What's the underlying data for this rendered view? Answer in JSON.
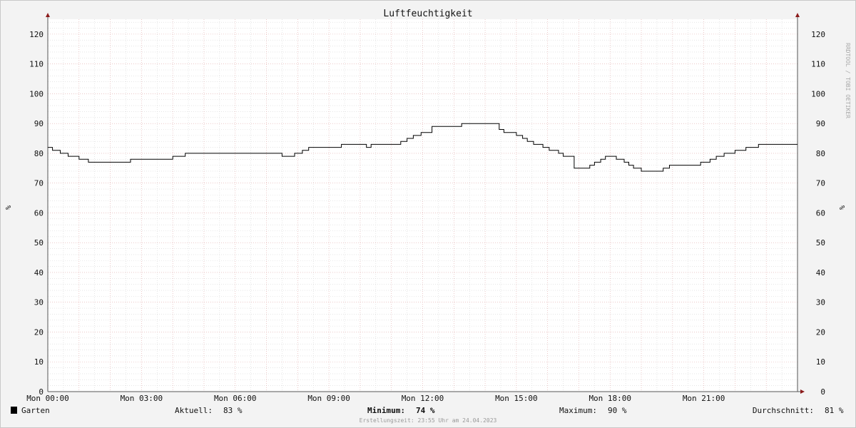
{
  "title": "Luftfeuchtigkeit",
  "watermark": "RRDTOOL / TOBI OETIKER",
  "chart_data": {
    "type": "line",
    "title": "Luftfeuchtigkeit",
    "ylabel": "%",
    "ylabel_right": "%",
    "xlabel": "",
    "ylim": [
      0,
      125
    ],
    "yticks": [
      0,
      10,
      20,
      30,
      40,
      50,
      60,
      70,
      80,
      90,
      100,
      110,
      120
    ],
    "xlim_hours": [
      0,
      24
    ],
    "xtick_hours": [
      0,
      3,
      6,
      9,
      12,
      15,
      18,
      21
    ],
    "xtick_labels": [
      "Mon 00:00",
      "Mon 03:00",
      "Mon 06:00",
      "Mon 09:00",
      "Mon 12:00",
      "Mon 15:00",
      "Mon 18:00",
      "Mon 21:00"
    ],
    "grid": true,
    "line_color": "#000000",
    "series": [
      {
        "name": "Garten",
        "x": [
          0,
          0.15,
          0.4,
          0.5,
          0.65,
          0.7,
          1.0,
          1.3,
          2.65,
          4.0,
          4.4,
          7.5,
          7.9,
          8.15,
          8.35,
          8.6,
          9.4,
          10.2,
          10.35,
          10.9,
          11.3,
          11.5,
          11.7,
          11.95,
          12.3,
          13.25,
          14.45,
          14.6,
          15.0,
          15.2,
          15.35,
          15.55,
          15.85,
          16.05,
          16.35,
          16.5,
          16.85,
          17.35,
          17.5,
          17.7,
          17.85,
          18.2,
          18.45,
          18.6,
          18.75,
          19.0,
          19.7,
          19.9,
          20.35,
          20.9,
          21.2,
          21.4,
          21.65,
          22.0,
          22.35,
          22.75,
          24.0
        ],
        "values": [
          82,
          81,
          80,
          80,
          79,
          79,
          78,
          77,
          78,
          79,
          80,
          79,
          80,
          81,
          82,
          82,
          83,
          82,
          83,
          83,
          84,
          85,
          86,
          87,
          89,
          90,
          88,
          87,
          86,
          85,
          84,
          83,
          82,
          81,
          80,
          79,
          75,
          76,
          77,
          78,
          79,
          78,
          77,
          76,
          75,
          74,
          75,
          76,
          76,
          77,
          78,
          79,
          80,
          81,
          82,
          83,
          83
        ]
      }
    ]
  },
  "legend": {
    "series_name": "Garten",
    "swatch_color": "#000000",
    "aktuell_label": "Aktuell:",
    "aktuell_value": "83 %",
    "minimum_label": "Minimum:",
    "minimum_value": "74 %",
    "maximum_label": "Maximum:",
    "maximum_value": "90 %",
    "durchschnitt_label": "Durchschnitt:",
    "durchschnitt_value": "81 %"
  },
  "footer": "Erstellungszeit: 23:55 Uhr am 24.04.2023"
}
